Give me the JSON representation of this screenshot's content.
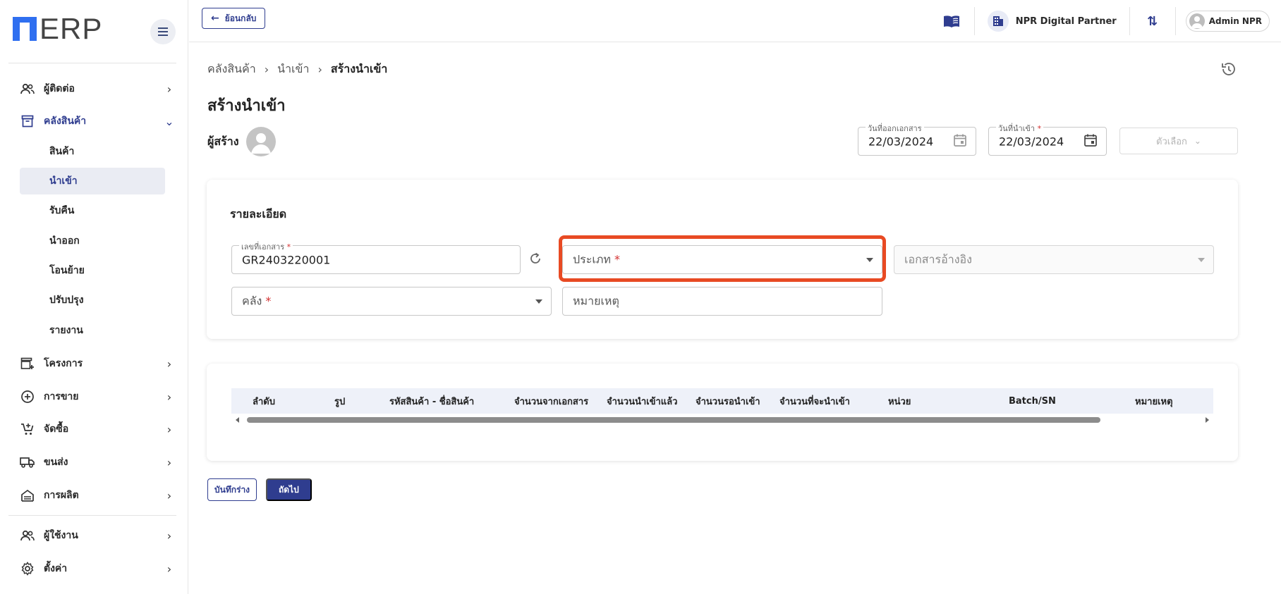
{
  "app": {
    "logo_text": "ERP",
    "brand_color": "#2f6ff0",
    "accent_color": "#2f3d8f",
    "highlight_color": "#e84a23"
  },
  "sidebar": {
    "items": [
      {
        "label": "ผู้ติดต่อ",
        "icon": "contacts-icon",
        "expanded": false
      },
      {
        "label": "คลังสินค้า",
        "icon": "warehouse-box-icon",
        "expanded": true,
        "children": [
          {
            "label": "สินค้า",
            "selected": false
          },
          {
            "label": "นำเข้า",
            "selected": true
          },
          {
            "label": "รับคืน",
            "selected": false
          },
          {
            "label": "นำออก",
            "selected": false
          },
          {
            "label": "โอนย้าย",
            "selected": false
          },
          {
            "label": "ปรับปรุง",
            "selected": false
          },
          {
            "label": "รายงาน",
            "selected": false
          }
        ]
      },
      {
        "label": "โครงการ",
        "icon": "project-building-icon",
        "expanded": false
      },
      {
        "label": "การขาย",
        "icon": "plus-circle-icon",
        "expanded": false
      },
      {
        "label": "จัดซื้อ",
        "icon": "cart-add-icon",
        "expanded": false
      },
      {
        "label": "ขนส่ง",
        "icon": "truck-icon",
        "expanded": false
      },
      {
        "label": "การผลิต",
        "icon": "factory-icon",
        "expanded": false
      }
    ],
    "bottom_items": [
      {
        "label": "ผู้ใช้งาน",
        "icon": "users-icon"
      },
      {
        "label": "ตั้งค่า",
        "icon": "gear-icon"
      }
    ]
  },
  "topbar": {
    "back_label": "ย้อนกลับ",
    "company": "NPR Digital Partner",
    "user": "Admin NPR"
  },
  "breadcrumb": [
    "คลังสินค้า",
    "นำเข้า",
    "สร้างนำเข้า"
  ],
  "page": {
    "title": "สร้างนำเข้า",
    "creator_label": "ผู้สร้าง",
    "issue_date_label": "วันที่ออกเอกสาร",
    "issue_date": "22/03/2024",
    "import_date_label": "วันที่นำเข้า",
    "import_date": "22/03/2024",
    "options_label": "ตัวเลือก"
  },
  "details": {
    "title": "รายละเอียด",
    "doc_no_label": "เลขที่เอกสาร",
    "doc_no": "GR2403220001",
    "type_placeholder": "ประเภท",
    "ref_doc_placeholder": "เอกสารอ้างอิง",
    "warehouse_placeholder": "คลัง",
    "remark_placeholder": "หมายเหตุ",
    "required_mark": "*"
  },
  "table": {
    "columns": [
      "ลำดับ",
      "รูป",
      "รหัสสินค้า - ชื่อสินค้า",
      "จำนวนจากเอกสาร",
      "จำนวนนำเข้าแล้ว",
      "จำนวนรอนำเข้า",
      "จำนวนที่จะนำเข้า",
      "หน่วย",
      "Batch/SN",
      "หมายเหตุ"
    ]
  },
  "actions": {
    "draft_label": "บันทึกร่าง",
    "next_label": "ถัดไป"
  }
}
